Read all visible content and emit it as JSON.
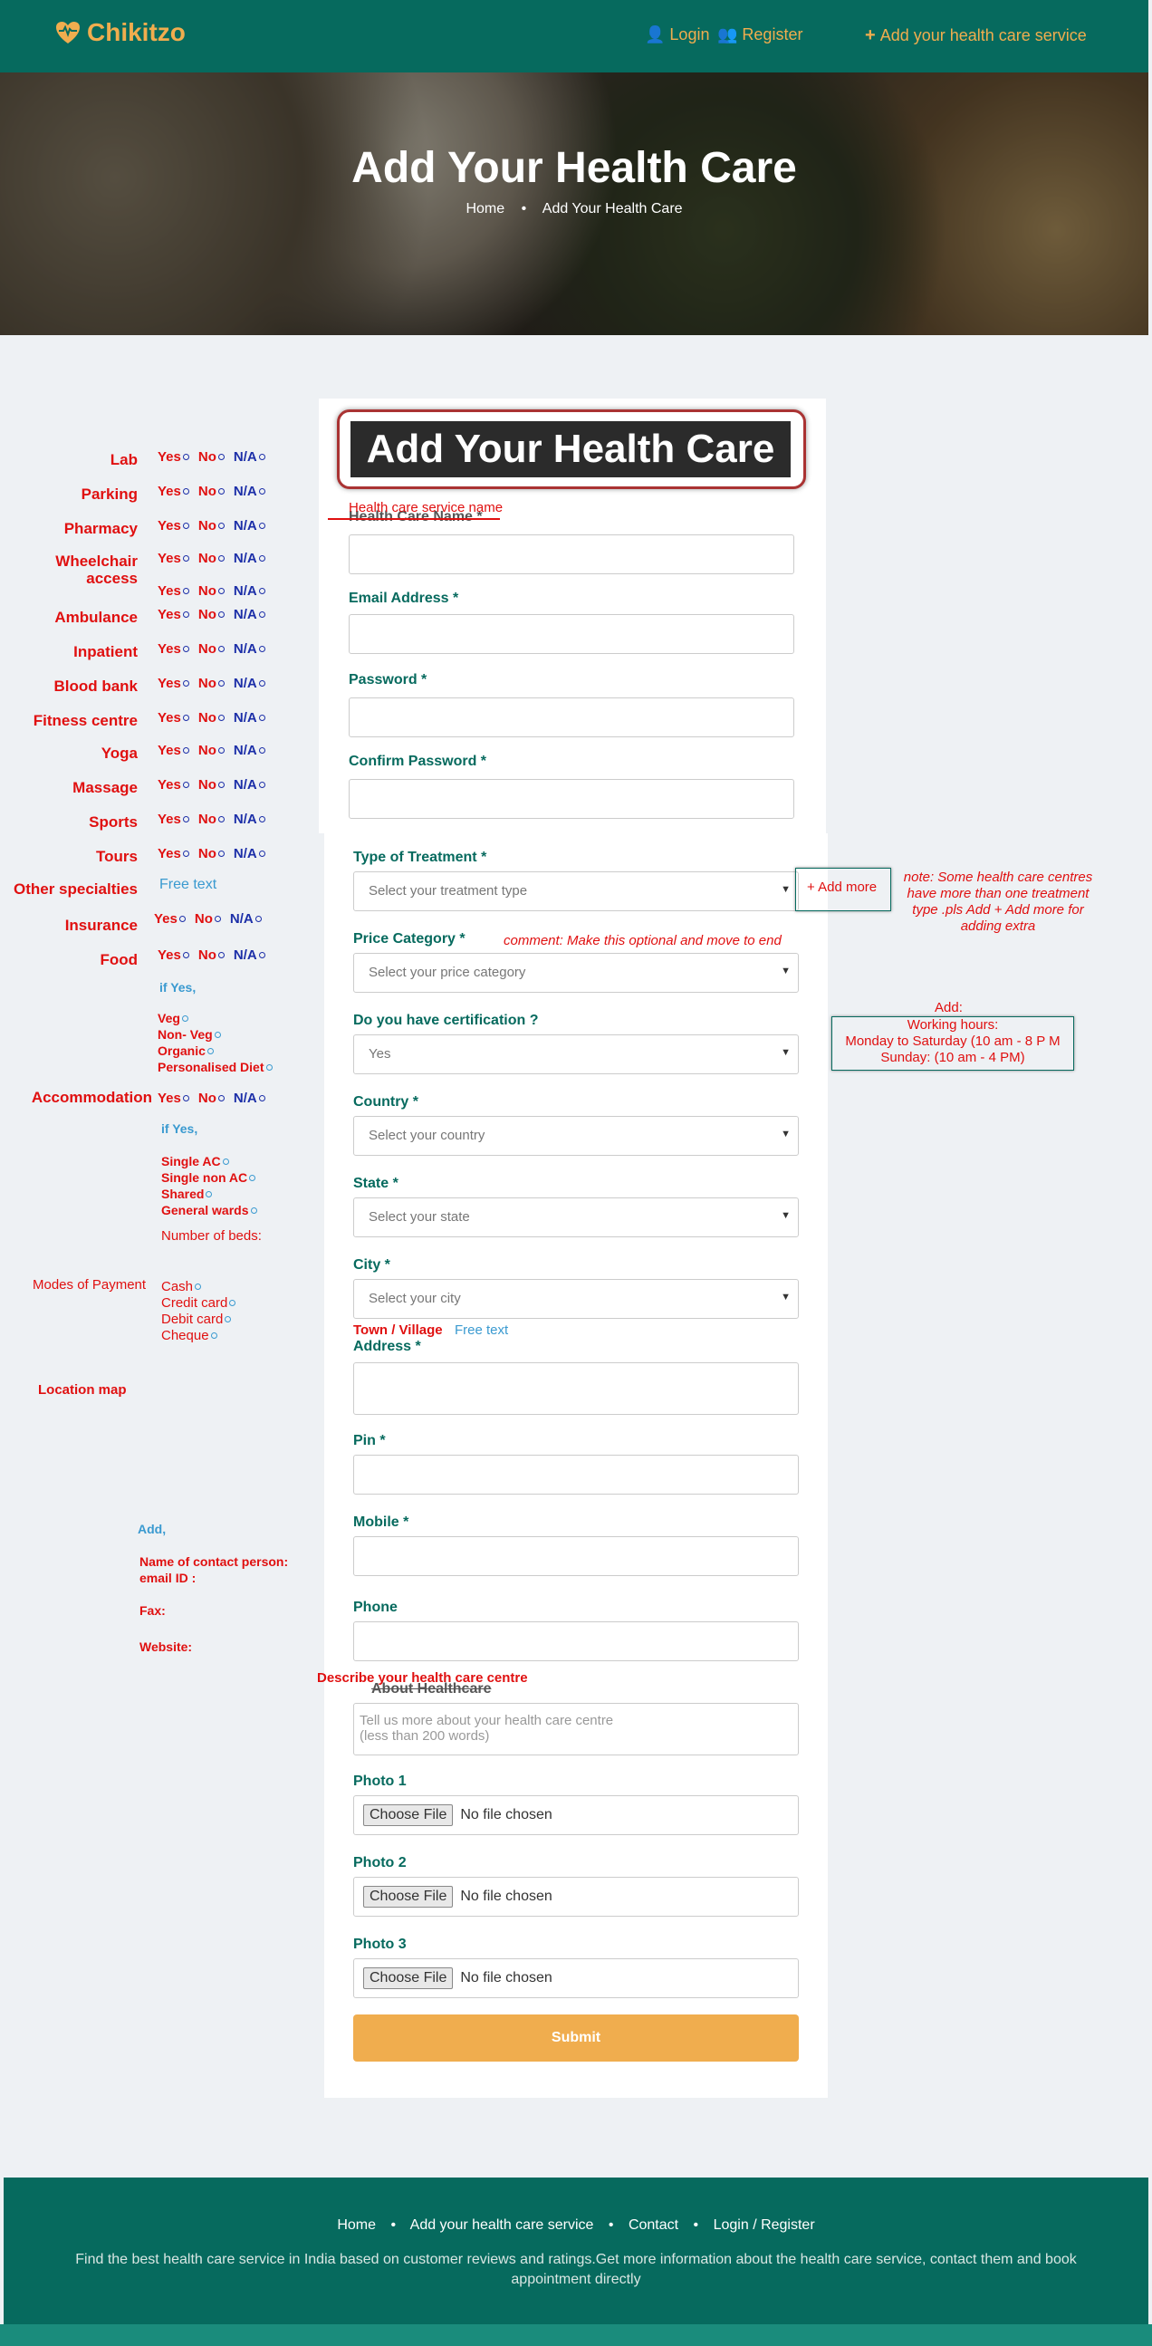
{
  "brand": {
    "name": "Chikitzo"
  },
  "nav": {
    "login": "Login",
    "register": "Register",
    "add_service": "Add your health care service"
  },
  "hero": {
    "title": "Add Your Health Care",
    "crumb_home": "Home",
    "crumb_current": "Add Your Health Care"
  },
  "form": {
    "title": "Add Your Health Care",
    "name_label": "Health Care Name *",
    "name_annotation": "Health care service name",
    "email_label": "Email Address *",
    "password_label": "Password *",
    "confirm_label": "Confirm Password *",
    "treatment_label": "Type of Treatment *",
    "treatment_placeholder": "Select your treatment type",
    "add_more": "+ Add more",
    "price_label": "Price Category *",
    "price_placeholder": "Select your price category",
    "price_comment": "comment: Make this optional and move to end",
    "cert_label": "Do you have certification ?",
    "cert_value": "Yes",
    "country_label": "Country *",
    "country_placeholder": "Select your country",
    "state_label": "State *",
    "state_placeholder": "Select your state",
    "city_label": "City *",
    "city_placeholder": "Select your city",
    "town_label": "Town / Village",
    "town_free": "Free text",
    "address_label": "Address *",
    "pin_label": "Pin *",
    "mobile_label": "Mobile *",
    "phone_label": "Phone",
    "about_label": "About Healthcare",
    "about_annotation": "Describe your health care centre",
    "about_placeholder_1": "Tell us more about your health care centre",
    "about_placeholder_2": "(less than 200 words)",
    "photo1_label": "Photo 1",
    "photo2_label": "Photo 2",
    "photo3_label": "Photo 3",
    "choose_file": "Choose File",
    "no_file": "No file chosen",
    "submit": "Submit"
  },
  "notes": {
    "treatment_note": "note: Some health care centres have more than one treatment type .pls Add + Add more for adding extra",
    "hours_add": "Add:",
    "hours_title": "Working hours:",
    "hours_weekday": "Monday to Saturday (10 am - 8 P M",
    "hours_sunday": "Sunday: (10 am - 4 PM)"
  },
  "left": {
    "yes": "Yes",
    "no": "No",
    "na": "N/A",
    "items": [
      "Lab",
      "Parking",
      "Pharmacy",
      "Wheelchair access",
      "Ambulance",
      "Inpatient",
      "Blood bank",
      "Fitness centre",
      "Yoga",
      "Massage",
      "Sports",
      "Tours"
    ],
    "other_specialties": "Other specialties",
    "free_text": "Free text",
    "insurance": "Insurance",
    "food": "Food",
    "if_yes": "if Yes,",
    "food_options": [
      "Veg",
      "Non- Veg",
      "Organic",
      "Personalised Diet"
    ],
    "accommodation": "Accommodation",
    "accom_options": [
      "Single AC",
      "Single non AC",
      "Shared",
      "General wards"
    ],
    "beds": "Number of beds:",
    "payment": "Modes of Payment",
    "payment_options": [
      "Cash",
      "Credit card",
      "Debit card",
      "Cheque"
    ],
    "location_map": "Location map",
    "add": "Add,",
    "contact_person": "Name of contact person:",
    "email_id": "email ID :",
    "fax": "Fax:",
    "website": "Website:"
  },
  "footer": {
    "home": "Home",
    "add_service": "Add your health care service",
    "contact": "Contact",
    "login_register": "Login / Register",
    "description": "Find the best health care service in India based on customer reviews and ratings.Get more information about the health care service, contact them and book appointment directly"
  },
  "colors": {
    "header": "#066a5e",
    "accent": "#f0ad4e",
    "annotation": "#e01010"
  }
}
